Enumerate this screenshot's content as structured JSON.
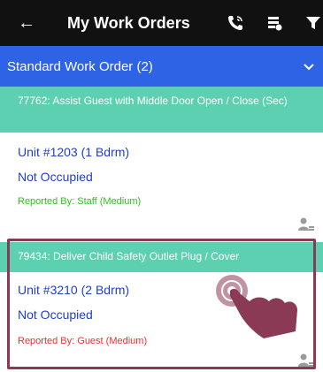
{
  "header": {
    "title": "My Work Orders",
    "icons": [
      "back-arrow-icon",
      "phone-icon",
      "filter-settings-icon",
      "funnel-icon"
    ]
  },
  "section": {
    "label": "Standard Work Order (2)",
    "icon": "chevron-down-icon"
  },
  "work_orders": [
    {
      "heading": "77762: Assist Guest with Middle Door Open / Close (Sec)",
      "unit": "Unit #1203 (1 Bdrm)",
      "occupancy": "Not Occupied",
      "reported": "Reported By: Staff (Medium)",
      "reported_color": "#2ec11f"
    },
    {
      "heading": "79434: Deliver Child Safety Outlet Plug / Cover",
      "unit": "Unit #3210 (2 Bdrm)",
      "occupancy": "Not Occupied",
      "reported": "Reported By: Guest (Medium)",
      "reported_color": "#ef2f2f"
    }
  ],
  "colors": {
    "topbar": "#111111",
    "section_header": "#2f63e6",
    "work_order_header": "#5ed0b2",
    "unit_text": "#1f3fc8",
    "highlight_frame": "#8a3a55"
  }
}
